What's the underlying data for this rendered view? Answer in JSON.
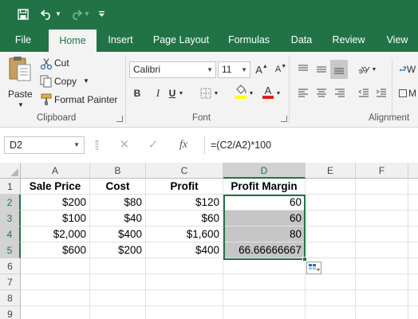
{
  "colors": {
    "brand": "#217346",
    "ribbon_bg": "#f3f3f3",
    "selection_fill": "#c6c6c6"
  },
  "qat": {
    "icons": [
      "save-icon",
      "undo-icon",
      "redo-icon",
      "customize-qat-icon"
    ]
  },
  "tabs": [
    {
      "label": "File"
    },
    {
      "label": "Home"
    },
    {
      "label": "Insert"
    },
    {
      "label": "Page Layout"
    },
    {
      "label": "Formulas"
    },
    {
      "label": "Data"
    },
    {
      "label": "Review"
    },
    {
      "label": "View"
    }
  ],
  "ribbon": {
    "clipboard": {
      "paste": "Paste",
      "cut": "Cut",
      "copy": "Copy",
      "format_painter": "Format Painter",
      "label": "Clipboard"
    },
    "font": {
      "font_name": "Calibri",
      "font_size": "11",
      "bold": "B",
      "italic": "I",
      "underline": "U",
      "grow": "A",
      "shrink": "A",
      "font_color": "A",
      "label": "Font"
    },
    "alignment": {
      "label": "Alignment",
      "wrap_partial": "W",
      "merge_partial": "M"
    }
  },
  "formula_bar": {
    "name_box": "D2",
    "fx": "fx",
    "formula": "=(C2/A2)*100"
  },
  "sheet": {
    "columns": [
      "A",
      "B",
      "C",
      "D",
      "E",
      "F"
    ],
    "rows": [
      "1",
      "2",
      "3",
      "4",
      "5",
      "6",
      "7",
      "8",
      "9"
    ],
    "cells": {
      "A1": "Sale Price",
      "B1": "Cost",
      "C1": "Profit",
      "D1": "Profit Margin",
      "A2": "$200",
      "B2": "$80",
      "C2": "$120",
      "D2": "60",
      "A3": "$100",
      "B3": "$40",
      "C3": "$60",
      "D3": "60",
      "A4": "$2,000",
      "B4": "$400",
      "C4": "$1,600",
      "D4": "80",
      "A5": "$600",
      "B5": "$200",
      "C5": "$400",
      "D5": "66.66666667"
    },
    "selected_column": "D",
    "selected_rows": [
      "2",
      "3",
      "4",
      "5"
    ]
  }
}
